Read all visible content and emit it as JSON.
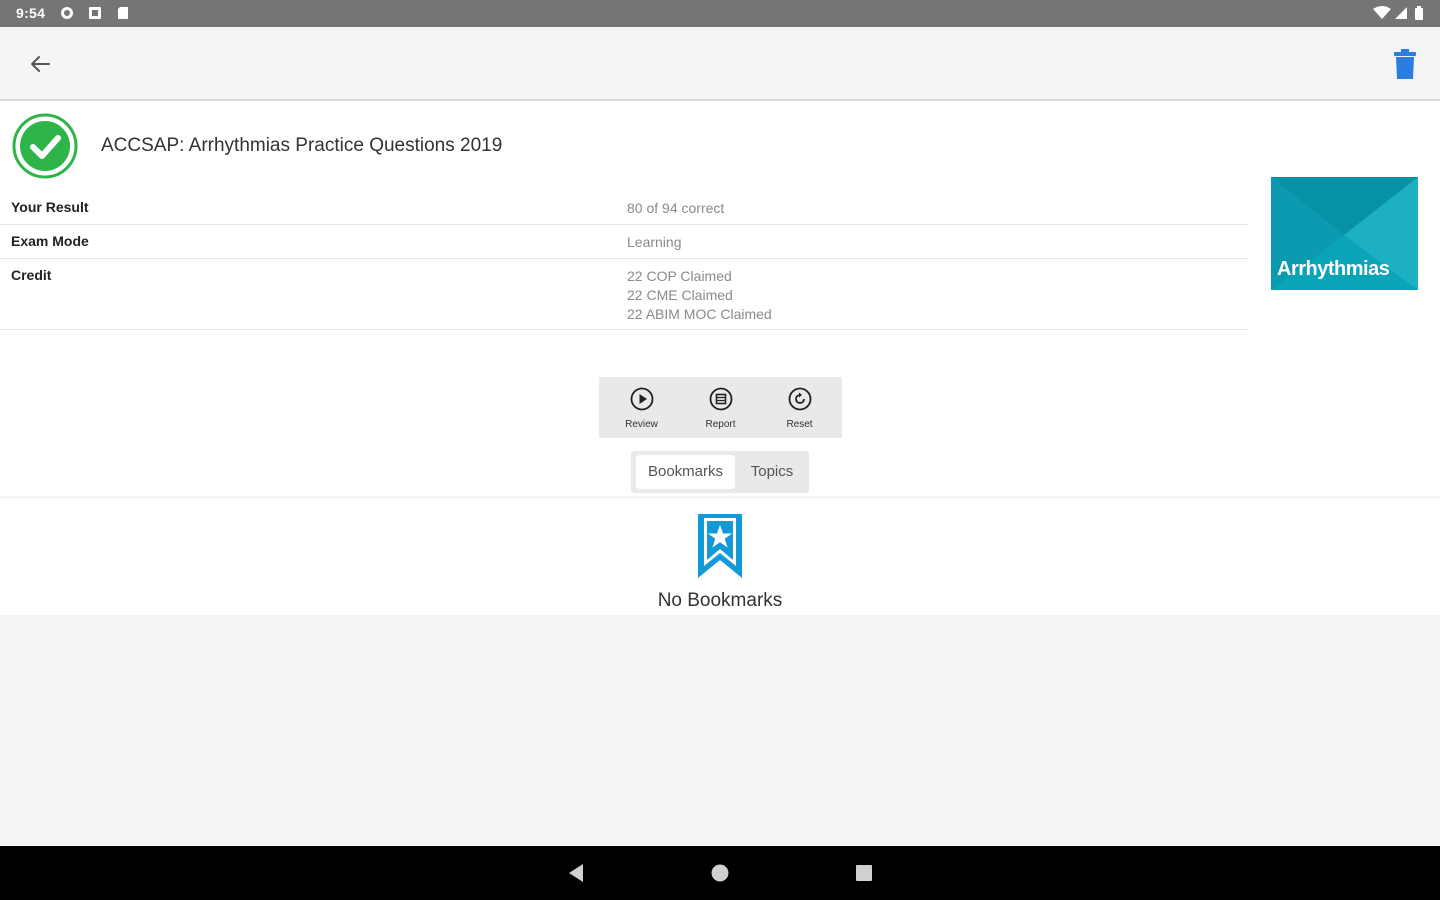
{
  "status_bar": {
    "time": "9:54",
    "left_icons": [
      "gear-icon",
      "notification-icon",
      "sd-card-icon"
    ],
    "right_icons": [
      "wifi-icon",
      "cell-signal-icon",
      "battery-icon"
    ]
  },
  "app_bar": {
    "back_icon": "arrow-back-icon",
    "delete_icon": "trash-icon",
    "accent_color": "#2a7de1"
  },
  "exam": {
    "title": "ACCSAP: Arrhythmias Practice Questions 2019",
    "status_icon": "check-circle-icon",
    "status_color": "#2db54a",
    "rows": [
      {
        "label": "Your Result",
        "values": [
          "80 of 94 correct"
        ]
      },
      {
        "label": "Exam Mode",
        "values": [
          "Learning"
        ]
      },
      {
        "label": "Credit",
        "values": [
          "22 COP Claimed",
          "22 CME Claimed",
          "22 ABIM MOC Claimed"
        ]
      }
    ],
    "cover_text": "Arrhythmias",
    "cover_color": "#0aa3b8"
  },
  "actions": [
    {
      "label": "Review",
      "icon": "play-circle-icon"
    },
    {
      "label": "Report",
      "icon": "report-circle-icon"
    },
    {
      "label": "Reset",
      "icon": "reset-circle-icon"
    }
  ],
  "tabs": {
    "items": [
      "Bookmarks",
      "Topics"
    ],
    "selected": "Bookmarks"
  },
  "empty_state": {
    "icon": "bookmark-star-icon",
    "text": "No Bookmarks"
  },
  "nav_bar": {
    "icons": [
      "nav-back-icon",
      "nav-home-icon",
      "nav-recents-icon"
    ]
  }
}
